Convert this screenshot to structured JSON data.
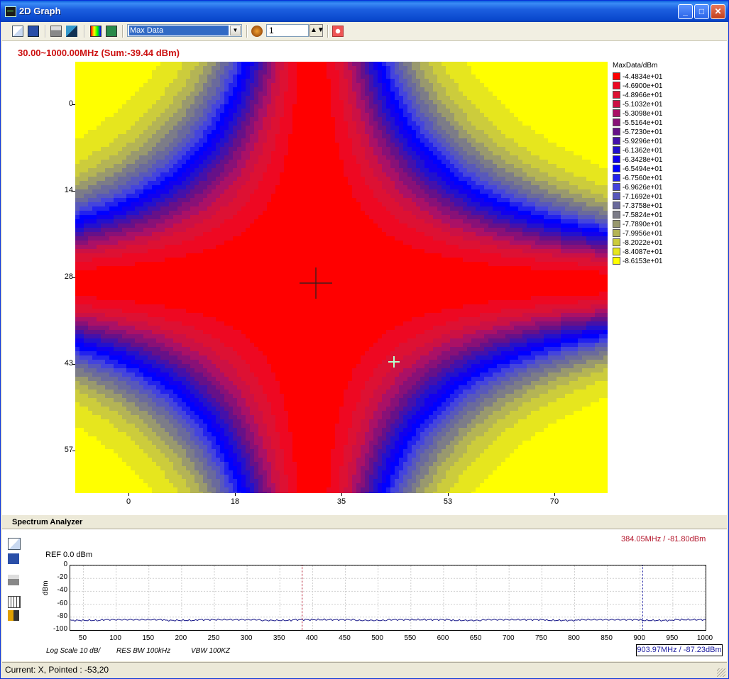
{
  "window": {
    "title": "2D Graph"
  },
  "toolbar": {
    "data_select_value": "Max Data",
    "spin_value": "1",
    "icons": [
      "copy-icon",
      "save-icon",
      "print-icon",
      "display-icon",
      "color-palette-icon",
      "refresh-image-icon",
      "record-icon",
      "stop-icon"
    ]
  },
  "graph": {
    "title": "30.00~1000.00MHz (Sum:-39.44 dBm)",
    "y_ticks": [
      "0",
      "14",
      "28",
      "43",
      "57"
    ],
    "x_ticks": [
      "0",
      "18",
      "35",
      "53",
      "70"
    ],
    "legend_title": "MaxData/dBm",
    "legend": [
      {
        "label": "-4.4834e+01",
        "color": "#ff0000"
      },
      {
        "label": "-4.6900e+01",
        "color": "#ee0822"
      },
      {
        "label": "-4.8966e+01",
        "color": "#dd1133"
      },
      {
        "label": "-5.1032e+01",
        "color": "#cc1144"
      },
      {
        "label": "-5.3098e+01",
        "color": "#aa1166"
      },
      {
        "label": "-5.5164e+01",
        "color": "#881177"
      },
      {
        "label": "-5.7230e+01",
        "color": "#661188"
      },
      {
        "label": "-5.9296e+01",
        "color": "#4411aa"
      },
      {
        "label": "-6.1362e+01",
        "color": "#2211cc"
      },
      {
        "label": "-6.3428e+01",
        "color": "#1100ee"
      },
      {
        "label": "-6.5494e+01",
        "color": "#0000ff"
      },
      {
        "label": "-6.7560e+01",
        "color": "#2222ee"
      },
      {
        "label": "-6.9626e+01",
        "color": "#4444dd"
      },
      {
        "label": "-7.1692e+01",
        "color": "#5858bb"
      },
      {
        "label": "-7.3758e+01",
        "color": "#6a6a9c"
      },
      {
        "label": "-7.5824e+01",
        "color": "#7c7c88"
      },
      {
        "label": "-7.7890e+01",
        "color": "#99996e"
      },
      {
        "label": "-7.9956e+01",
        "color": "#b4b455"
      },
      {
        "label": "-8.2022e+01",
        "color": "#cccc3c"
      },
      {
        "label": "-8.4087e+01",
        "color": "#e6e61e"
      },
      {
        "label": "-8.6153e+01",
        "color": "#ffff00"
      }
    ]
  },
  "spectrum": {
    "header": "Spectrum Analyzer",
    "marker_top": "384.05MHz / -81.80dBm",
    "marker_bottom": "903.97MHz / -87.23dBm",
    "ref": "REF  0.0 dBm",
    "ylabel": "dBm",
    "y_ticks": [
      "0",
      "-20",
      "-40",
      "-60",
      "-80",
      "-100"
    ],
    "x_ticks": [
      "50",
      "100",
      "150",
      "200",
      "250",
      "300",
      "350",
      "400",
      "450",
      "500",
      "550",
      "600",
      "650",
      "700",
      "750",
      "800",
      "850",
      "900",
      "950",
      "1000"
    ],
    "footer": {
      "scale": "Log Scale 10 dB/",
      "rbw": "RES BW 100kHz",
      "vbw": "VBW 100KZ"
    },
    "tools": [
      "copy-icon",
      "save-icon",
      "print-icon",
      "table-icon",
      "sort-icon"
    ]
  },
  "status": {
    "text": "Current: X, Pointed : -53,20"
  },
  "chart_data": {
    "type": "line",
    "title": "",
    "xlabel": "",
    "ylabel": "dBm",
    "xlim": [
      30,
      1000
    ],
    "ylim": [
      -100,
      0
    ],
    "grid": true,
    "series": [
      {
        "values": [
          -85,
          -84,
          -84,
          -85,
          -84,
          -84,
          -85,
          -84,
          -84,
          -85,
          -84,
          -84,
          -85,
          -84,
          -84,
          -85,
          -84,
          -84,
          -85,
          -84
        ]
      }
    ],
    "x": [
      50,
      100,
      150,
      200,
      250,
      300,
      350,
      400,
      450,
      500,
      550,
      600,
      650,
      700,
      750,
      800,
      850,
      900,
      950,
      1000
    ],
    "markers": [
      {
        "x": 384.05,
        "y": -81.8
      },
      {
        "x": 903.97,
        "y": -87.23
      }
    ]
  }
}
